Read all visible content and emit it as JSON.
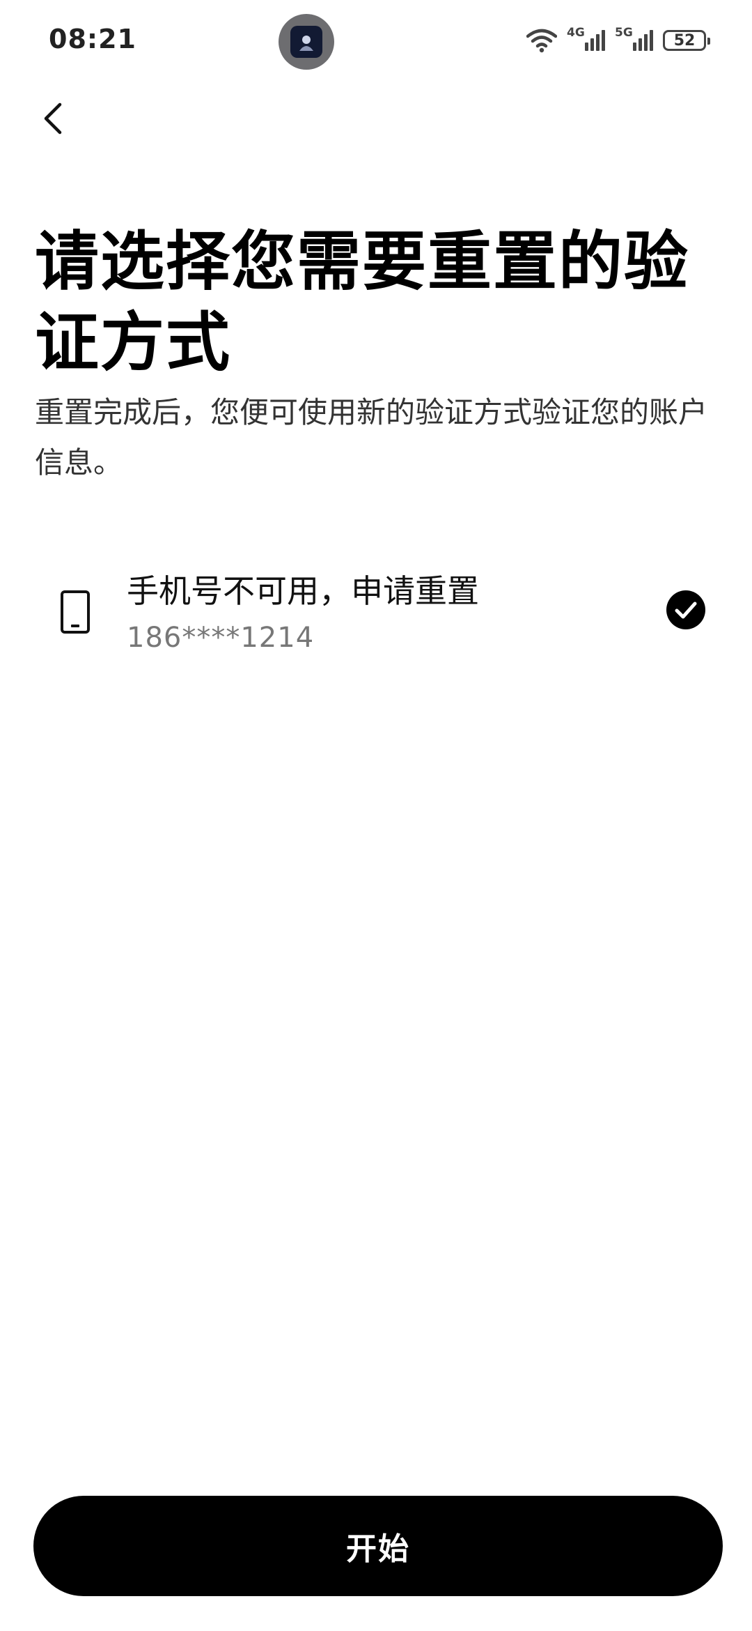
{
  "status_bar": {
    "time": "08:21",
    "network_1": "4G",
    "network_2": "5G",
    "battery": "52",
    "icons": [
      "wifi-icon",
      "signal-icon",
      "battery-icon"
    ]
  },
  "nav": {
    "back_icon": "chevron-left-icon"
  },
  "header": {
    "title": "请选择您需要重置的验证方式",
    "description": "重置完成后，您便可使用新的验证方式验证您的账户信息。"
  },
  "options": [
    {
      "icon": "phone-icon",
      "title": "手机号不可用，申请重置",
      "subtitle": "186****1214",
      "selected": true
    }
  ],
  "footer": {
    "start_label": "开始"
  },
  "colors": {
    "primary": "#000000",
    "background": "#ffffff",
    "muted_text": "#777777"
  }
}
